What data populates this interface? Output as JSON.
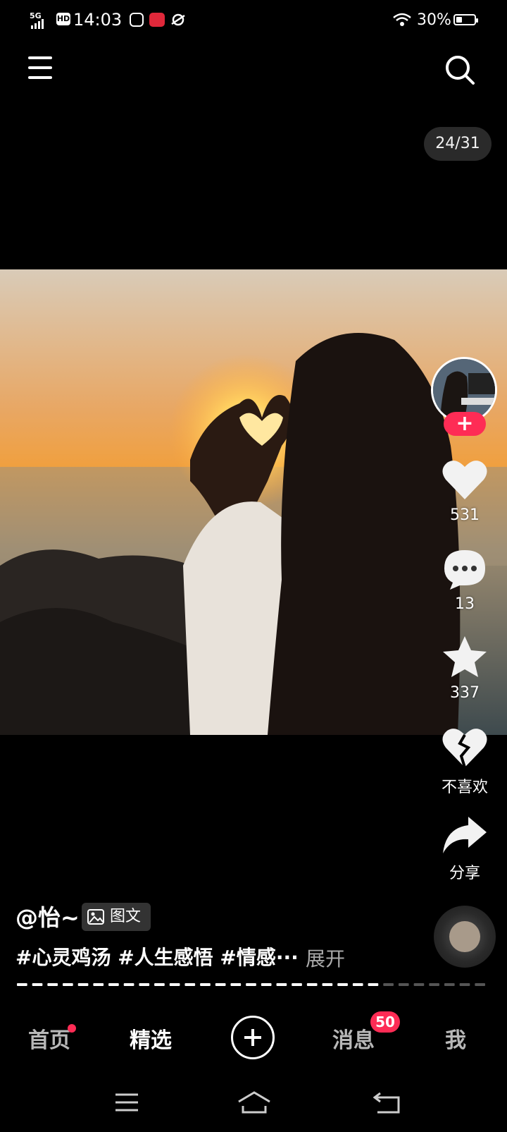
{
  "status_bar": {
    "network": "5G",
    "hd": "HD",
    "time": "14:03",
    "battery": "30%",
    "battery_level": 0.3
  },
  "counter": "24/31",
  "rail": {
    "likes": "531",
    "comments": "13",
    "favorites": "337",
    "dislike_label": "不喜欢",
    "share_label": "分享"
  },
  "caption": {
    "author": "@怡~",
    "badge": "图文",
    "hashtags": "#心灵鸡汤 #人生感悟 #情感···",
    "expand": "展开"
  },
  "pages": {
    "current": 24,
    "total": 31
  },
  "bottom_nav": {
    "home": "首页",
    "featured": "精选",
    "messages": "消息",
    "messages_badge": "50",
    "me": "我"
  },
  "colors": {
    "accent": "#fe2c55",
    "background": "#000000"
  }
}
